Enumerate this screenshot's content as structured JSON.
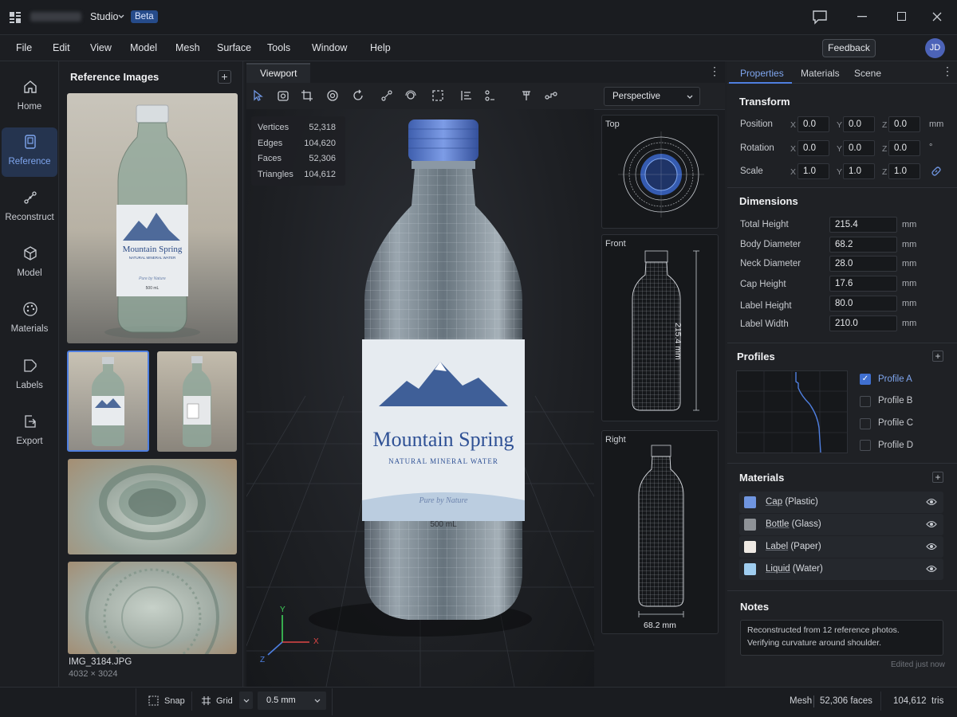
{
  "app": {
    "name": "Studio",
    "badge": "Beta"
  },
  "menu": [
    "File",
    "Edit",
    "View",
    "Model",
    "Mesh",
    "Surface",
    "Tools",
    "Window",
    "Help"
  ],
  "feedback_label": "Feedback",
  "avatar_initials": "JD",
  "rail": [
    {
      "label": "Home",
      "icon": "home-icon"
    },
    {
      "label": "Reference",
      "icon": "reference-icon",
      "active": true
    },
    {
      "label": "Reconstruct",
      "icon": "reconstruct-icon"
    },
    {
      "label": "Model",
      "icon": "cube-icon"
    },
    {
      "label": "Materials",
      "icon": "palette-icon"
    },
    {
      "label": "Labels",
      "icon": "label-icon"
    },
    {
      "label": "Export",
      "icon": "export-icon"
    }
  ],
  "reference": {
    "title": "Reference Images",
    "selected_file": "IMG_3184.JPG",
    "selected_dims": "4032 × 3024",
    "label_brand": "Mountain Spring",
    "label_sub": "NATURAL MINERAL WATER",
    "label_tag": "Pure by Nature",
    "label_volume": "500 mL"
  },
  "viewport": {
    "tab": "Viewport",
    "projection": "Perspective",
    "stats": [
      {
        "label": "Vertices",
        "value": "52,318"
      },
      {
        "label": "Edges",
        "value": "104,620"
      },
      {
        "label": "Faces",
        "value": "52,306"
      },
      {
        "label": "Triangles",
        "value": "104,612"
      }
    ],
    "views": {
      "top": "Top",
      "front": "Front",
      "right": "Right"
    },
    "height_dim": "215.4 mm",
    "diameter_dim": "68.2 mm",
    "axes": {
      "x": "X",
      "y": "Y",
      "z": "Z"
    },
    "label_brand": "Mountain Spring",
    "label_sub": "NATURAL MINERAL WATER",
    "label_tag": "Pure by Nature",
    "label_volume": "500 mL"
  },
  "right_tabs": [
    "Properties",
    "Materials",
    "Scene"
  ],
  "transform": {
    "title": "Transform",
    "rows": [
      {
        "label": "Position",
        "x": "0.0",
        "y": "0.0",
        "z": "0.0",
        "unit": "mm"
      },
      {
        "label": "Rotation",
        "x": "0.0",
        "y": "0.0",
        "z": "0.0",
        "unit": "°"
      },
      {
        "label": "Scale",
        "x": "1.0",
        "y": "1.0",
        "z": "1.0",
        "unit": ""
      }
    ]
  },
  "dimensions": {
    "title": "Dimensions",
    "rows": [
      {
        "label": "Total Height",
        "value": "215.4",
        "unit": "mm"
      },
      {
        "label": "Body Diameter",
        "value": "68.2",
        "unit": "mm"
      },
      {
        "label": "Neck Diameter",
        "value": "28.0",
        "unit": "mm"
      },
      {
        "label": "Cap Height",
        "value": "17.6",
        "unit": "mm"
      },
      {
        "label": "Label Height",
        "value": "80.0",
        "unit": "mm"
      },
      {
        "label": "Label Width",
        "value": "210.0",
        "unit": "mm"
      }
    ]
  },
  "profiles": {
    "title": "Profiles",
    "items": [
      {
        "label": "Profile A",
        "checked": true
      },
      {
        "label": "Profile B",
        "checked": false
      },
      {
        "label": "Profile C",
        "checked": false
      },
      {
        "label": "Profile D",
        "checked": false
      }
    ]
  },
  "materials": {
    "title": "Materials",
    "items": [
      {
        "name": "Cap",
        "type": "(Plastic)",
        "color": "#6f95e0"
      },
      {
        "name": "Bottle",
        "type": "(Glass)",
        "color": "#8e9297"
      },
      {
        "name": "Label",
        "type": "(Paper)",
        "color": "#efeae4"
      },
      {
        "name": "Liquid",
        "type": "(Water)",
        "color": "#9fcdf0"
      }
    ]
  },
  "notes": {
    "title": "Notes",
    "line1": "Reconstructed from 12 reference photos.",
    "line2": "Verifying curvature around shoulder.",
    "edited": "Edited just now"
  },
  "status": {
    "snap": "Snap",
    "grid": "Grid",
    "grid_size": "0.5 mm",
    "mesh_label": "Mesh",
    "faces": "52,306 faces",
    "tris_value": "104,612",
    "tris_label": "tris"
  }
}
